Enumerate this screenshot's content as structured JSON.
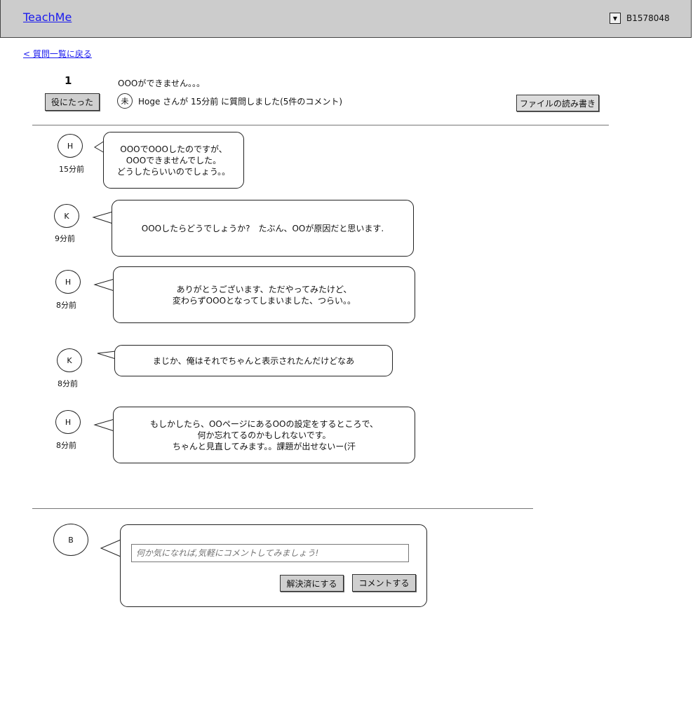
{
  "header": {
    "logo": "TeachMe",
    "dropdown_glyph": "▼",
    "user_id": "B1578048"
  },
  "back_link": "< 質問一覧に戻る",
  "question": {
    "vote_count": "1",
    "useful_label": "役にたった",
    "title": "OOOができません。。。",
    "status_badge": "未",
    "meta": "Hoge さんが 15分前 に質問しました(5件のコメント)",
    "file_button": "ファイルの読み書き"
  },
  "comments": [
    {
      "avatar": "H",
      "time": "15分前",
      "text": "OOOでOOOしたのですが、\nOOOできませんでした。\nどうしたらいいのでしょう。。"
    },
    {
      "avatar": "K",
      "time": "9分前",
      "text": "OOOしたらどうでしょうか?　たぶん、OOが原因だと思います."
    },
    {
      "avatar": "H",
      "time": "8分前",
      "text": "ありがとうございます、ただやってみたけど、\n変わらずOOOとなってしまいました、つらい。。"
    },
    {
      "avatar": "K",
      "time": "8分前",
      "text": "まじか、俺はそれでちゃんと表示されたんだけどなあ"
    },
    {
      "avatar": "H",
      "time": "8分前",
      "text": "もしかしたら、OOページにあるOOの設定をするところで、\n何か忘れてるのかもしれないです。\nちゃんと見直してみます。。課題が出せないー(汗"
    }
  ],
  "composer": {
    "avatar": "B",
    "placeholder": "何か気になれば,気軽にコメントしてみましょう!",
    "resolve_button": "解決済にする",
    "comment_button": "コメントする"
  }
}
